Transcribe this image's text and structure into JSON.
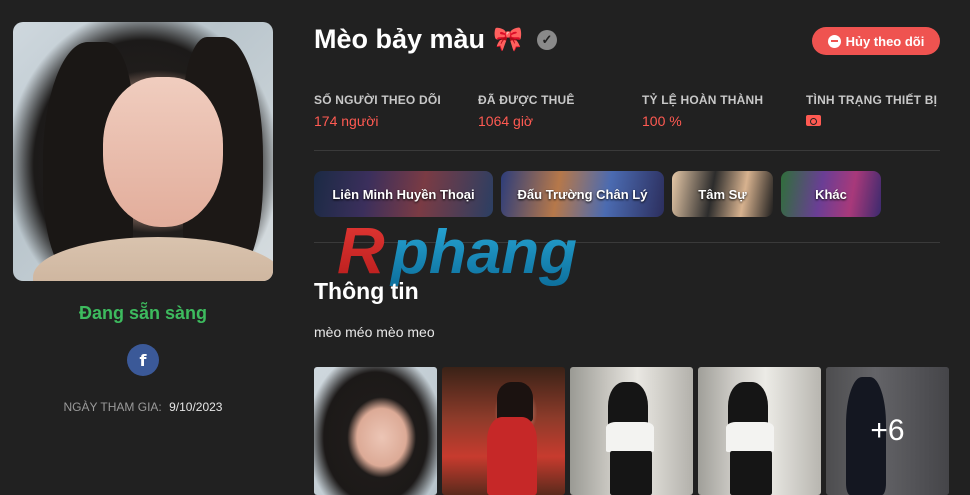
{
  "profile": {
    "name": "Mèo bảy màu",
    "name_emoji": "🎀",
    "status": "Đang sẵn sàng",
    "facebook_label": "f",
    "join_label": "NGÀY THAM GIA:",
    "join_date": "9/10/2023"
  },
  "actions": {
    "unfollow_label": "Hủy theo dõi"
  },
  "stats": [
    {
      "label": "SỐ NGƯỜI THEO DÕI",
      "value": "174 người"
    },
    {
      "label": "ĐÃ ĐƯỢC THUÊ",
      "value": "1064 giờ"
    },
    {
      "label": "TỶ LỆ HOÀN THÀNH",
      "value": "100 %"
    },
    {
      "label": "TÌNH TRẠNG THIẾT BỊ",
      "value_icon": "camera-icon"
    }
  ],
  "games": [
    {
      "label": "Liên Minh Huyền Thoại"
    },
    {
      "label": "Đấu Trường Chân Lý"
    },
    {
      "label": "Tâm Sự"
    },
    {
      "label": "Khác"
    }
  ],
  "watermark": "Rphang",
  "info": {
    "title": "Thông tin",
    "bio": "mèo méo mèo meo"
  },
  "gallery": {
    "more_label": "+6"
  },
  "colors": {
    "background": "#212121",
    "accent_red": "#ff5a52",
    "status_green": "#3dbb5e",
    "facebook_blue": "#3b5998",
    "unfollow_bg": "#ef5350"
  }
}
